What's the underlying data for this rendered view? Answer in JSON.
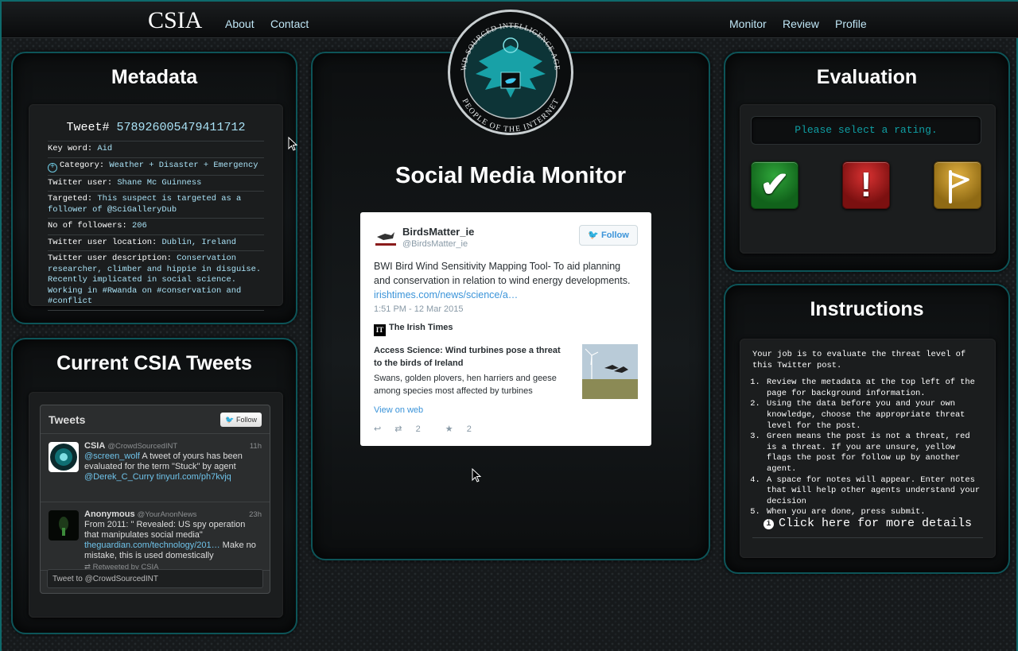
{
  "navbar": {
    "brand": "CSIA",
    "left_links": [
      "About",
      "Contact"
    ],
    "right_links": [
      "Monitor",
      "Review",
      "Profile"
    ]
  },
  "metadata": {
    "title": "Metadata",
    "tweet_id_label": "Tweet#",
    "tweet_id": "578926005479411712",
    "rows": {
      "keyword_label": "Key word:",
      "keyword": "Aid",
      "category_label": "Category:",
      "category": "Weather + Disaster + Emergency",
      "user_label": "Twitter user:",
      "user": "Shane Mc Guinness",
      "targeted_label": "Targeted:",
      "targeted": "This suspect is targeted as a follower of @SciGalleryDub",
      "followers_label": "No of followers:",
      "followers": "206",
      "location_label": "Twitter user location:",
      "location": "Dublin, Ireland",
      "description_label": "Twitter user description:",
      "description": "Conservation researcher, climber and hippie in disguise. Recently implicated in social science. Working in #Rwanda on #conservation and #conflict"
    }
  },
  "current": {
    "title": "Current CSIA Tweets",
    "timeline_title": "Tweets",
    "follow_label": "Follow",
    "tweets": [
      {
        "name": "CSIA",
        "handle": "@CrowdSourcedINT",
        "time": "11h",
        "link1": "@screen_wolf",
        "text": " A tweet of yours has been evaluated for the term \"Stuck\" by agent ",
        "link2": "@Derek_C_Curry tinyurl.com/ph7kvjq"
      },
      {
        "name": "Anonymous",
        "handle": "@YourAnonNews",
        "time": "23h",
        "text": "From 2011: \" Revealed: US spy operation that manipulates social media\" ",
        "link": "theguardian.com/technology/201…",
        "text2": " Make no mistake, this is used domestically",
        "retweet": "Retweeted by CSIA"
      }
    ],
    "tweet_to": "Tweet to @CrowdSourcedINT"
  },
  "seal": {
    "top_text": "CROWD-SOURCED INTELLIGENCE AGENCY",
    "bottom_text": "PEOPLE OF THE INTERNET"
  },
  "monitor": {
    "title": "Social Media Monitor",
    "card": {
      "name": "BirdsMatter_ie",
      "handle": "@BirdsMatter_ie",
      "follow": "Follow",
      "text": "BWI Bird Wind Sensitivity Mapping Tool- To aid planning and conservation in relation to wind energy developments. ",
      "link": "irishtimes.com/news/science/a…",
      "time": "1:51 PM - 12 Mar 2015",
      "source": "The Irish Times",
      "source_logo": "IT",
      "article_title": "Access Science: Wind turbines pose a threat to the birds of Ireland",
      "article_desc": "Swans, golden plovers, hen harriers and geese among species most affected by turbines",
      "view_web": "View on web",
      "retweets": "2",
      "favorites": "2"
    }
  },
  "evaluation": {
    "title": "Evaluation",
    "placeholder": "Please select a rating.",
    "green_symbol": "✔",
    "red_symbol": "!"
  },
  "instructions": {
    "title": "Instructions",
    "intro": "Your job is to evaluate the threat level of this Twitter post.",
    "steps": [
      "Review the metadata at the top left of the page for background information.",
      "Using the data before you and your own knowledge, choose the appropriate threat level for the post.",
      "Green means the post is not a threat, red is a threat. If you are unsure, yellow flags the post for follow up by another agent.",
      "A space for notes will appear. Enter notes that will help other agents understand your decision",
      "When you are done, press submit."
    ],
    "more": "Click here for more details"
  }
}
